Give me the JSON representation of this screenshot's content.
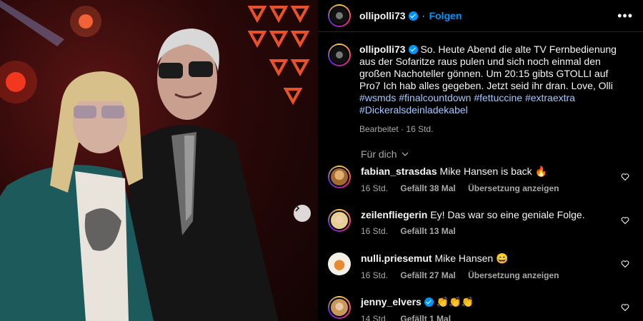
{
  "post": {
    "username": "ollipolli73",
    "follow_label": "Folgen",
    "more_label": "•••",
    "caption_text": "So. Heute Abend die alte TV Fernbedienung aus der Sofaritze raus pulen und sich noch einmal den großen Nachoteller gönnen. Um 20:15 gibts GTOLLI auf Pro7 Ich hab alles gegeben. Jetzt seid ihr dran. Love, Olli",
    "hashtags": [
      "#wsmds",
      "#finalcountdown",
      "#fettuccine",
      "#extraextra",
      "#Dickeralsdeinladekabel"
    ],
    "edited": "Bearbeitet",
    "age": "16 Std.",
    "separator": "·"
  },
  "sort_label": "Für dich",
  "comments": [
    {
      "user": "fabian_strasdas",
      "text": "Mike Hansen is back 🔥",
      "age": "16 Std.",
      "likes": "Gefällt 38 Mal",
      "translate": "Übersetzung anzeigen",
      "verified": false
    },
    {
      "user": "zeilenfliegerin",
      "text": "Ey! Das war so eine geniale Folge.",
      "age": "16 Std.",
      "likes": "Gefällt 13 Mal",
      "translate": "",
      "verified": false
    },
    {
      "user": "nulli.priesemut",
      "text": "Mike Hansen 😄",
      "age": "16 Std.",
      "likes": "Gefällt 27 Mal",
      "translate": "Übersetzung anzeigen",
      "verified": false
    },
    {
      "user": "jenny_elvers",
      "text": "👏👏👏",
      "age": "14 Std.",
      "likes": "Gefällt 1 Mal",
      "translate": "",
      "verified": true
    }
  ],
  "icons": {
    "next": "chevron-right-icon",
    "heart": "heart-outline-icon",
    "verified": "verified-badge-icon",
    "sort": "chevron-down-icon"
  },
  "colors": {
    "link": "#0095f6",
    "hashtag": "#a3c8ff",
    "muted": "#a8a8a8"
  }
}
